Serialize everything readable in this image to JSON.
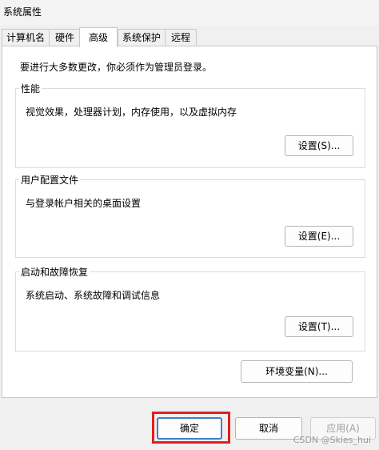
{
  "window": {
    "title": "系统属性"
  },
  "tabs": [
    {
      "label": "计算机名",
      "active": false
    },
    {
      "label": "硬件",
      "active": false
    },
    {
      "label": "高级",
      "active": true
    },
    {
      "label": "系统保护",
      "active": false
    },
    {
      "label": "远程",
      "active": false
    }
  ],
  "panel": {
    "notice": "要进行大多数更改，你必须作为管理员登录。",
    "groups": [
      {
        "title": "性能",
        "description": "视觉效果，处理器计划，内存使用，以及虚拟内存",
        "button": "设置(S)..."
      },
      {
        "title": "用户配置文件",
        "description": "与登录帐户相关的桌面设置",
        "button": "设置(E)..."
      },
      {
        "title": "启动和故障恢复",
        "description": "系统启动、系统故障和调试信息",
        "button": "设置(T)..."
      }
    ],
    "env_button": "环境变量(N)..."
  },
  "footer": {
    "ok": "确定",
    "cancel": "取消",
    "apply": "应用(A)"
  },
  "watermark": "CSDN @Skies_hui",
  "colors": {
    "highlight": "#e0201f",
    "focus_border": "#3f7fd0"
  }
}
